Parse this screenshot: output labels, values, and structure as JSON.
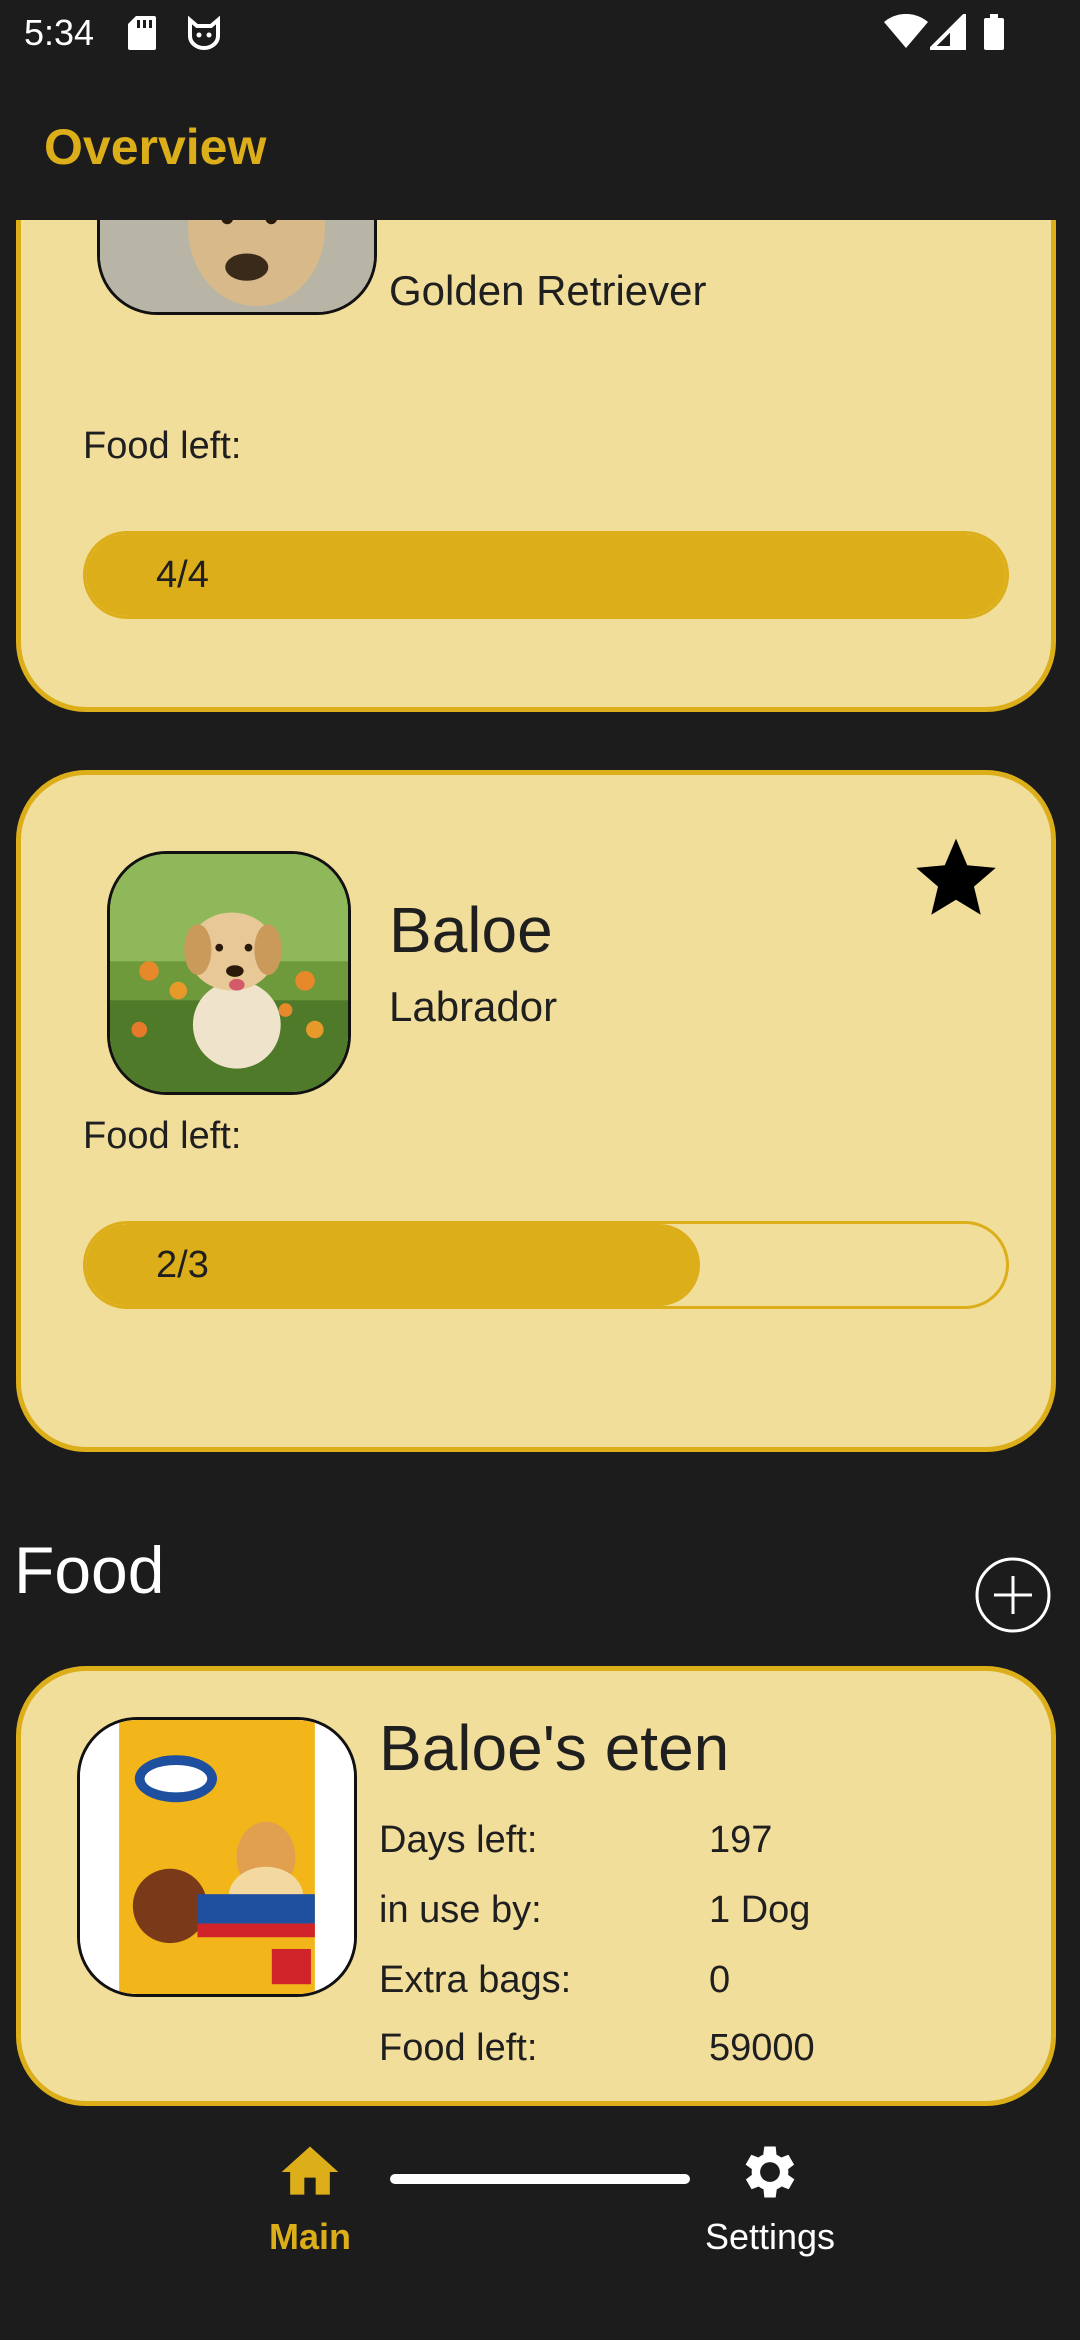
{
  "status_bar": {
    "time": "5:34",
    "icons": [
      "sd-card-icon",
      "cat-icon",
      "wifi-icon",
      "signal-icon",
      "battery-icon"
    ]
  },
  "app_bar": {
    "title": "Overview",
    "accent_color": "#dcae1a"
  },
  "pets": [
    {
      "name": "",
      "breed": "Golden Retriever",
      "food_left_label": "Food left:",
      "progress_text": "4/4",
      "progress_fraction": 1.0
    },
    {
      "name": "Baloe",
      "breed": "Labrador",
      "favorite": true,
      "food_left_label": "Food left:",
      "progress_text": "2/3",
      "progress_fraction": 0.667
    }
  ],
  "food_section": {
    "title": "Food",
    "add_icon": "add-circle-icon",
    "items": [
      {
        "name": "Baloe's eten",
        "rows": [
          {
            "label": "Days left:",
            "value": "197"
          },
          {
            "label": "in use by:",
            "value": "1 Dog"
          },
          {
            "label": "Extra bags:",
            "value": "0"
          },
          {
            "label": "Food left:",
            "value": "59000"
          }
        ]
      }
    ]
  },
  "bottom_nav": {
    "items": [
      {
        "label": "Main",
        "icon": "home-icon",
        "active": true
      },
      {
        "label": "Settings",
        "icon": "gear-icon",
        "active": false
      }
    ]
  },
  "colors": {
    "background": "#1c1c1d",
    "card": "#f2de9b",
    "accent": "#dcae1a"
  }
}
